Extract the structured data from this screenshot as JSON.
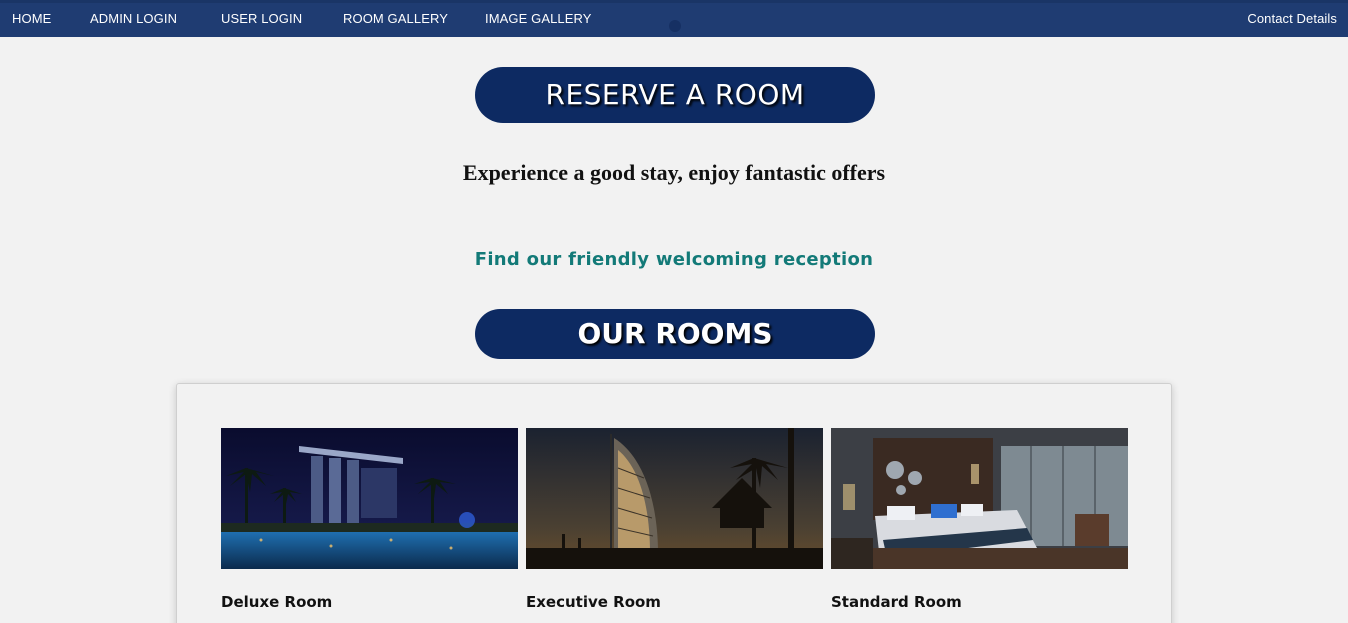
{
  "nav": {
    "items": [
      {
        "label": "HOME"
      },
      {
        "label": "ADMIN LOGIN"
      },
      {
        "label": "USER LOGIN"
      },
      {
        "label": "ROOM GALLERY"
      },
      {
        "label": "IMAGE GALLERY"
      }
    ],
    "contact": "Contact Details"
  },
  "hero": {
    "button": "RESERVE A ROOM",
    "tagline": "Experience a good stay, enjoy fantastic offers",
    "reception": "Find our friendly welcoming reception"
  },
  "rooms": {
    "heading": "OUR ROOMS",
    "items": [
      {
        "name": "Deluxe Room"
      },
      {
        "name": "Executive Room"
      },
      {
        "name": "Standard Room"
      }
    ]
  },
  "colors": {
    "nav_bg": "#1f3c72",
    "pill_bg": "#0d2a62",
    "reception_text": "#137a78",
    "page_bg": "#f2f2f2"
  }
}
